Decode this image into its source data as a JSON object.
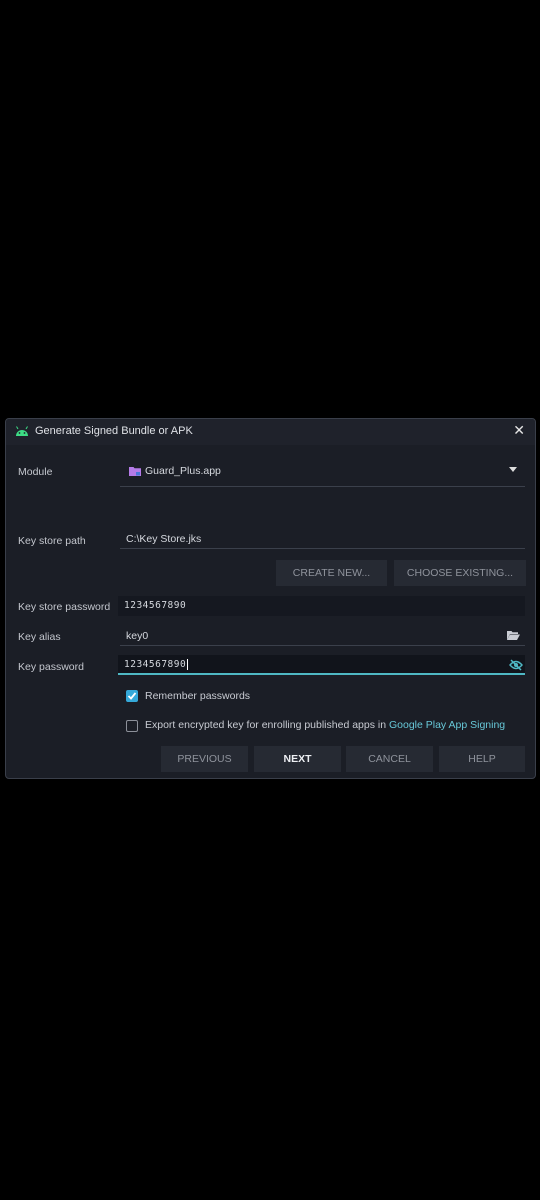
{
  "dialog": {
    "title": "Generate Signed Bundle or APK",
    "close_glyph": "✕"
  },
  "module": {
    "label": "Module",
    "value": "Guard_Plus.app"
  },
  "keystore": {
    "path_label": "Key store path",
    "path_value": "C:\\Key Store.jks",
    "create_new": "CREATE NEW...",
    "choose_existing": "CHOOSE EXISTING...",
    "password_label": "Key store password",
    "password_value": "1234567890"
  },
  "key": {
    "alias_label": "Key alias",
    "alias_value": "key0",
    "password_label": "Key password",
    "password_value": "1234567890"
  },
  "options": {
    "remember_label": "Remember passwords",
    "remember_checked": true,
    "export_label": "Export encrypted key for enrolling published apps in ",
    "export_link": "Google Play App Signing",
    "export_checked": false
  },
  "footer": {
    "previous": "PREVIOUS",
    "next": "NEXT",
    "cancel": "CANCEL",
    "help": "HELP"
  },
  "colors": {
    "background": "#000000",
    "dialog_bg": "#1b1e26",
    "accent": "#4fb8c4",
    "checkbox": "#35a9d9",
    "android_green": "#3ddc84"
  },
  "icons": {
    "title": "android-icon",
    "module": "folder-icon",
    "alias": "folder-open-icon",
    "password": "eye-slash-icon"
  }
}
